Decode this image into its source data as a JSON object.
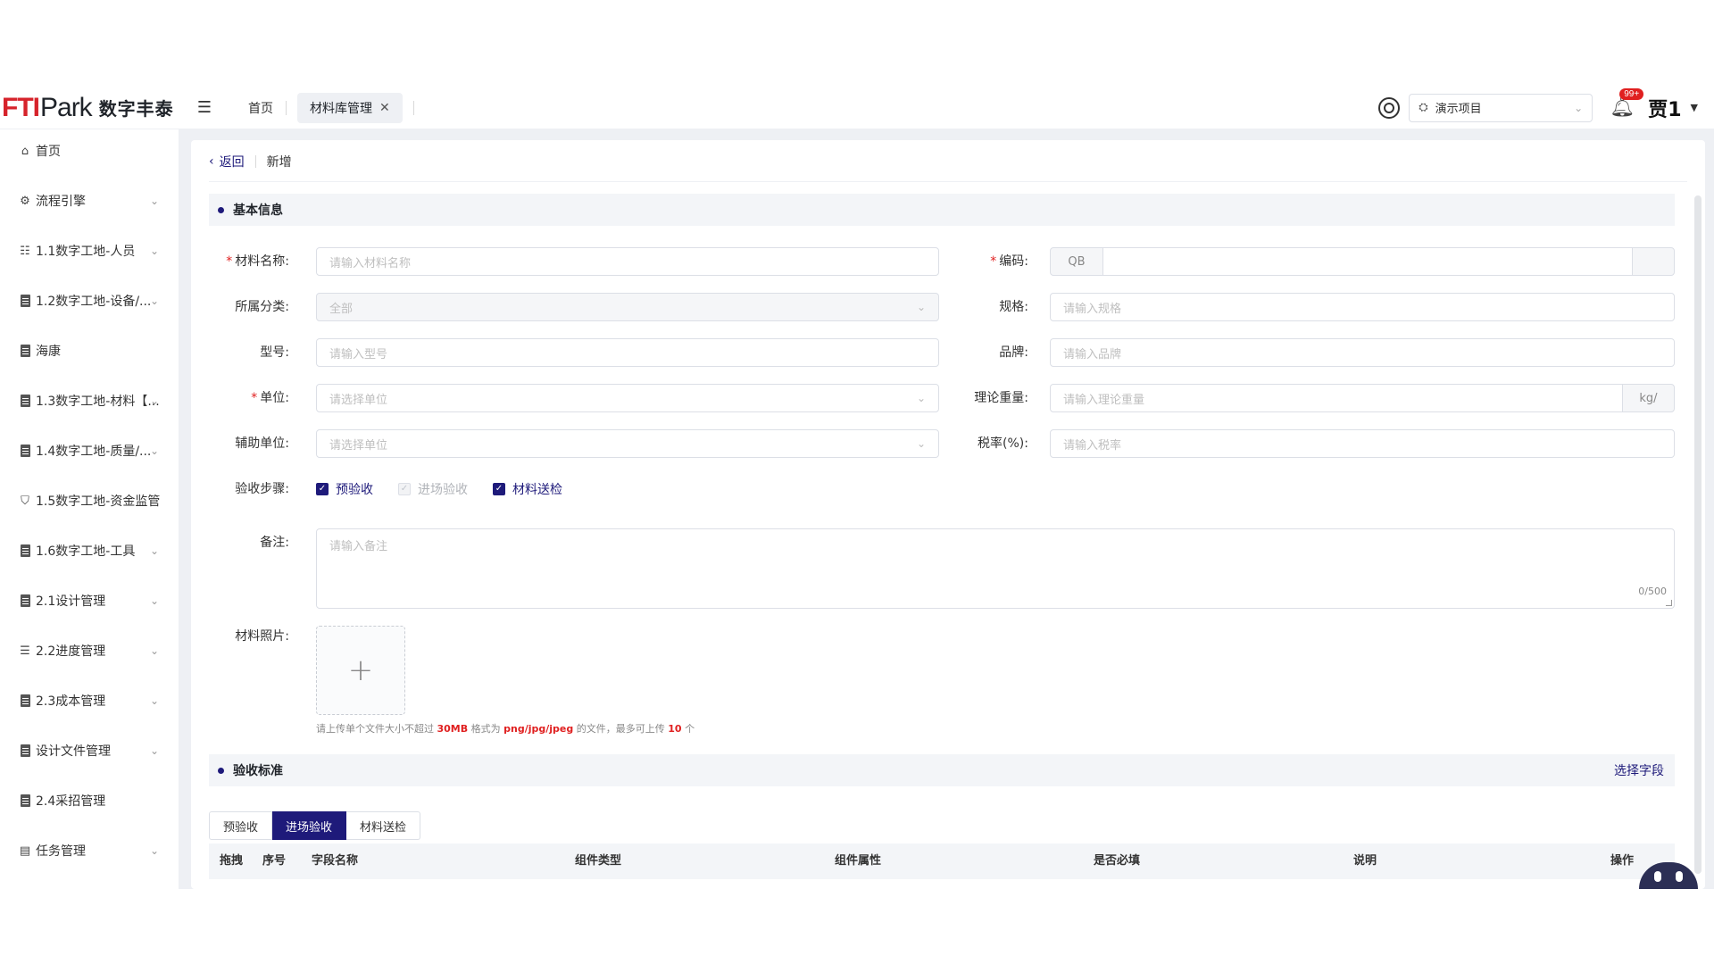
{
  "brand": {
    "mark": "FTI",
    "park": "Park",
    "cn": "数字丰泰"
  },
  "header": {
    "tabs": {
      "home": "首页",
      "active": "材料库管理"
    },
    "project": "演示项目",
    "badge": "99+",
    "user": "贾1"
  },
  "sidebar": {
    "items": [
      {
        "label": "首页",
        "icon": "home-icon"
      },
      {
        "label": "流程引擎",
        "icon": "workflow-icon"
      },
      {
        "label": "1.1数字工地-人员",
        "icon": "people-icon"
      },
      {
        "label": "1.2数字工地-设备/...",
        "icon": "document-icon"
      },
      {
        "label": "海康",
        "icon": "document-icon"
      },
      {
        "label": "1.3数字工地-材料【...",
        "icon": "document-icon"
      },
      {
        "label": "1.4数字工地-质量/...",
        "icon": "document-icon"
      },
      {
        "label": "1.5数字工地-资金监管",
        "icon": "shield-icon"
      },
      {
        "label": "1.6数字工地-工具",
        "icon": "document-icon"
      },
      {
        "label": "2.1设计管理",
        "icon": "document-icon"
      },
      {
        "label": "2.2进度管理",
        "icon": "gantt-icon"
      },
      {
        "label": "2.3成本管理",
        "icon": "document-icon"
      },
      {
        "label": "设计文件管理",
        "icon": "document-icon"
      },
      {
        "label": "2.4采招管理",
        "icon": "document-icon"
      },
      {
        "label": "任务管理",
        "icon": "task-icon"
      }
    ]
  },
  "breadcrumb": {
    "back": "返回",
    "current": "新增"
  },
  "sections": {
    "basic": "基本信息",
    "standard": "验收标准",
    "select_fields": "选择字段"
  },
  "form": {
    "name": {
      "label": "材料名称:",
      "placeholder": "请输入材料名称"
    },
    "code": {
      "label": "编码:",
      "prefix": "QB"
    },
    "category": {
      "label": "所属分类:",
      "value": "全部"
    },
    "spec": {
      "label": "规格:",
      "placeholder": "请输入规格"
    },
    "model": {
      "label": "型号:",
      "placeholder": "请输入型号"
    },
    "brand": {
      "label": "品牌:",
      "placeholder": "请输入品牌"
    },
    "unit": {
      "label": "单位:",
      "placeholder": "请选择单位"
    },
    "weight": {
      "label": "理论重量:",
      "placeholder": "请输入理论重量",
      "suffix": "kg/"
    },
    "aux_unit": {
      "label": "辅助单位:",
      "placeholder": "请选择单位"
    },
    "tax": {
      "label": "税率(%):",
      "placeholder": "请输入税率"
    },
    "steps": {
      "label": "验收步骤:",
      "options": [
        "预验收",
        "进场验收",
        "材料送检"
      ]
    },
    "remark": {
      "label": "备注:",
      "placeholder": "请输入备注",
      "count": "0/500"
    },
    "photo": {
      "label": "材料照片:"
    },
    "upload_tip": {
      "t1": "请上传单个文件大小不超过",
      "size": "30MB",
      "t2": "格式为",
      "fmt": "png/jpg/jpeg",
      "t3": "的文件，最多可上传",
      "num": "10",
      "t4": "个"
    }
  },
  "standard_tabs": [
    "预验收",
    "进场验收",
    "材料送检"
  ],
  "table_headers": [
    "拖拽",
    "序号",
    "字段名称",
    "组件类型",
    "组件属性",
    "是否必填",
    "说明",
    "操作"
  ]
}
